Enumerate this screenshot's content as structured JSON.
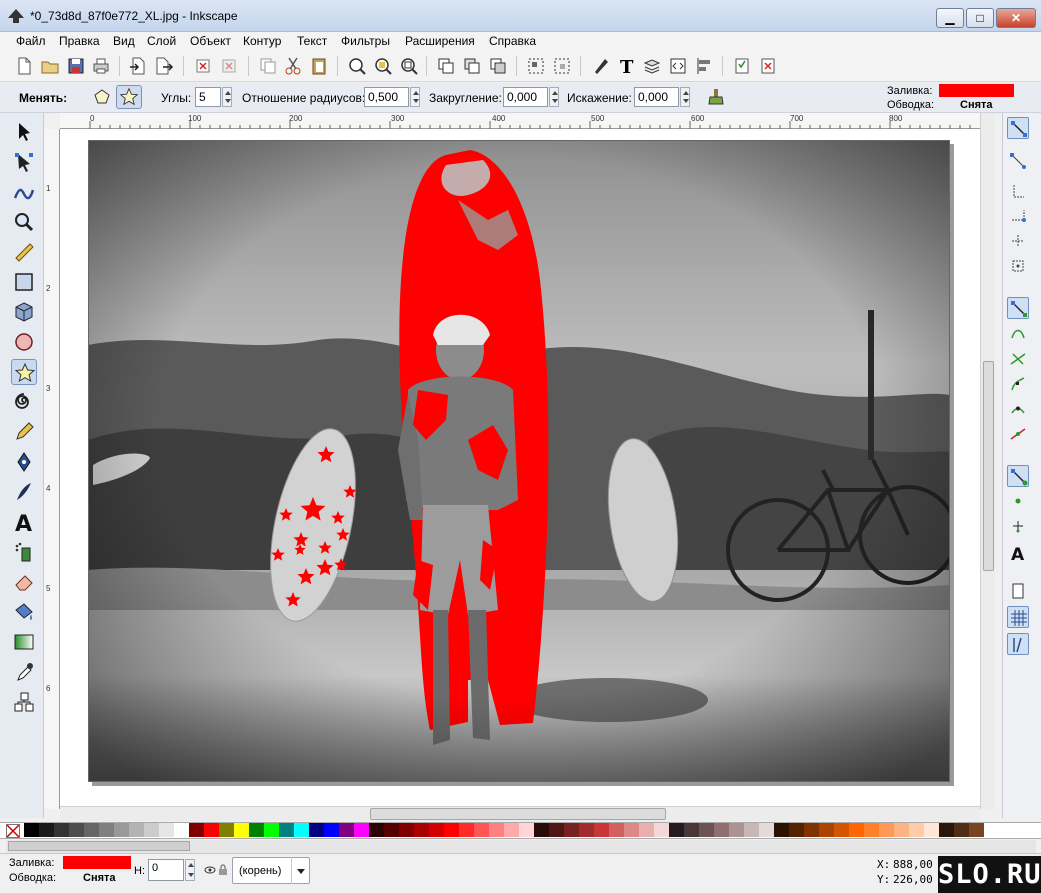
{
  "window": {
    "title": "*0_73d8d_87f0e772_XL.jpg - Inkscape"
  },
  "menu": [
    "Файл",
    "Правка",
    "Вид",
    "Слой",
    "Объект",
    "Контур",
    "Текст",
    "Фильтры",
    "Расширения",
    "Справка"
  ],
  "controls": {
    "change_label": "Менять:",
    "corners_label": "Углы:",
    "corners_value": "5",
    "ratio_label": "Отношение радиусов:",
    "ratio_value": "0,500",
    "rounding_label": "Закругление:",
    "rounding_value": "0,000",
    "distortion_label": "Искажение:",
    "distortion_value": "0,000"
  },
  "style_indicator": {
    "fill_label": "Заливка:",
    "stroke_label": "Обводка:",
    "stroke_value": "Снята",
    "fill_color": "#ff0000"
  },
  "ruler_h": [
    "0",
    "100",
    "200",
    "300",
    "400",
    "500",
    "600",
    "700",
    "800"
  ],
  "ruler_v": [
    "1",
    "2",
    "3",
    "4",
    "5",
    "6"
  ],
  "palette": [
    "#000000",
    "#1a1a1a",
    "#333333",
    "#4d4d4d",
    "#666666",
    "#808080",
    "#999999",
    "#b3b3b3",
    "#cccccc",
    "#e6e6e6",
    "#ffffff",
    "#800000",
    "#ff0000",
    "#808000",
    "#ffff00",
    "#008000",
    "#00ff00",
    "#008080",
    "#00ffff",
    "#000080",
    "#0000ff",
    "#800080",
    "#ff00ff",
    "#2b0000",
    "#550000",
    "#800000",
    "#aa0000",
    "#d40000",
    "#ff0000",
    "#ff2a2a",
    "#ff5555",
    "#ff8080",
    "#ffaaaa",
    "#ffd5d5",
    "#280b0b",
    "#501616",
    "#782121",
    "#a02c2c",
    "#c83737",
    "#d35f5f",
    "#de8787",
    "#e9afaf",
    "#f4d7d7",
    "#241c1c",
    "#483737",
    "#6c5353",
    "#916f6f",
    "#ac9393",
    "#c8b7b7",
    "#e3dbdb",
    "#2b1100",
    "#552200",
    "#803300",
    "#aa4400",
    "#d45500",
    "#ff6600",
    "#ff7f2a",
    "#ff9955",
    "#ffb380",
    "#ffccaa",
    "#ffe6d5",
    "#28170b",
    "#502d16",
    "#784421"
  ],
  "status": {
    "fill_label": "Заливка:",
    "stroke_label": "Обводка:",
    "stroke_value": "Снята",
    "h_label": "Н:",
    "h_value": "0",
    "layer_value": "(корень)",
    "x_label": "X:",
    "x_value": "888,00",
    "y_label": "Y:",
    "y_value": "226,00",
    "logo": "SLO.RU"
  }
}
